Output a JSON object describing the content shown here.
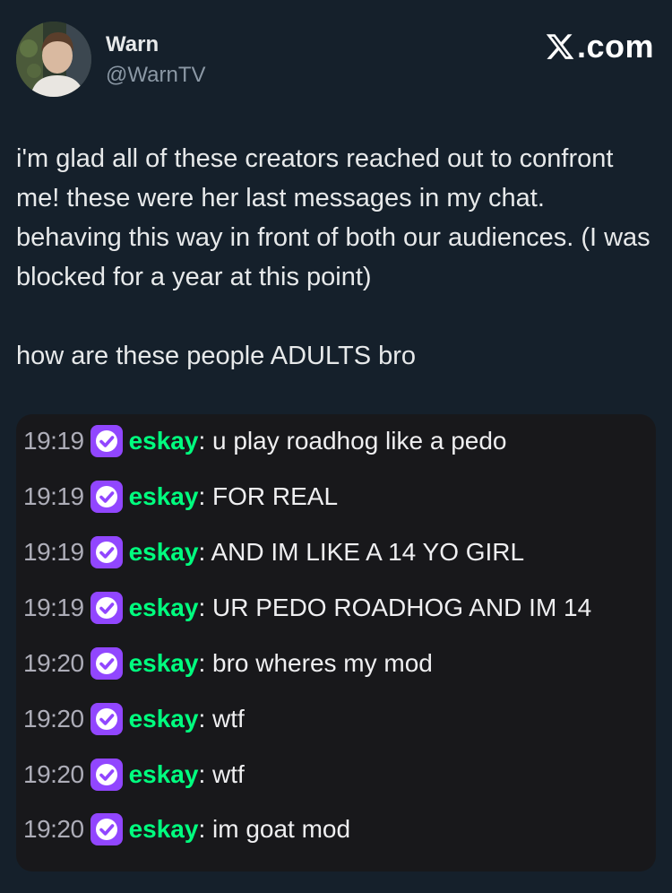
{
  "author": {
    "name": "Warn",
    "handle": "@WarnTV"
  },
  "brand": {
    "text": ".com",
    "logo_icon": "x-logo-icon"
  },
  "tweet": {
    "paragraph_1": "i'm glad all of these creators reached out to confront me! these were her last messages in my chat. behaving this way in front of both our audiences. (I was blocked for a year at this point)",
    "paragraph_2": "how are these people ADULTS bro"
  },
  "chat": {
    "badge_icon": "verified-badge-icon",
    "colors": {
      "background": "#18181b",
      "username": "#00ff7f",
      "badge": "#9146ff"
    },
    "messages": [
      {
        "time": "19:19",
        "user": "eskay",
        "text": ": u play roadhog like a pedo"
      },
      {
        "time": "19:19",
        "user": "eskay",
        "text": ": FOR REAL"
      },
      {
        "time": "19:19",
        "user": "eskay",
        "text": ": AND IM LIKE A 14 YO GIRL"
      },
      {
        "time": "19:19",
        "user": "eskay",
        "text": ": UR PEDO ROADHOG AND IM 14"
      },
      {
        "time": "19:20",
        "user": "eskay",
        "text": ": bro wheres my mod"
      },
      {
        "time": "19:20",
        "user": "eskay",
        "text": ": wtf"
      },
      {
        "time": "19:20",
        "user": "eskay",
        "text": ": wtf"
      },
      {
        "time": "19:20",
        "user": "eskay",
        "text": ": im goat mod"
      }
    ]
  }
}
